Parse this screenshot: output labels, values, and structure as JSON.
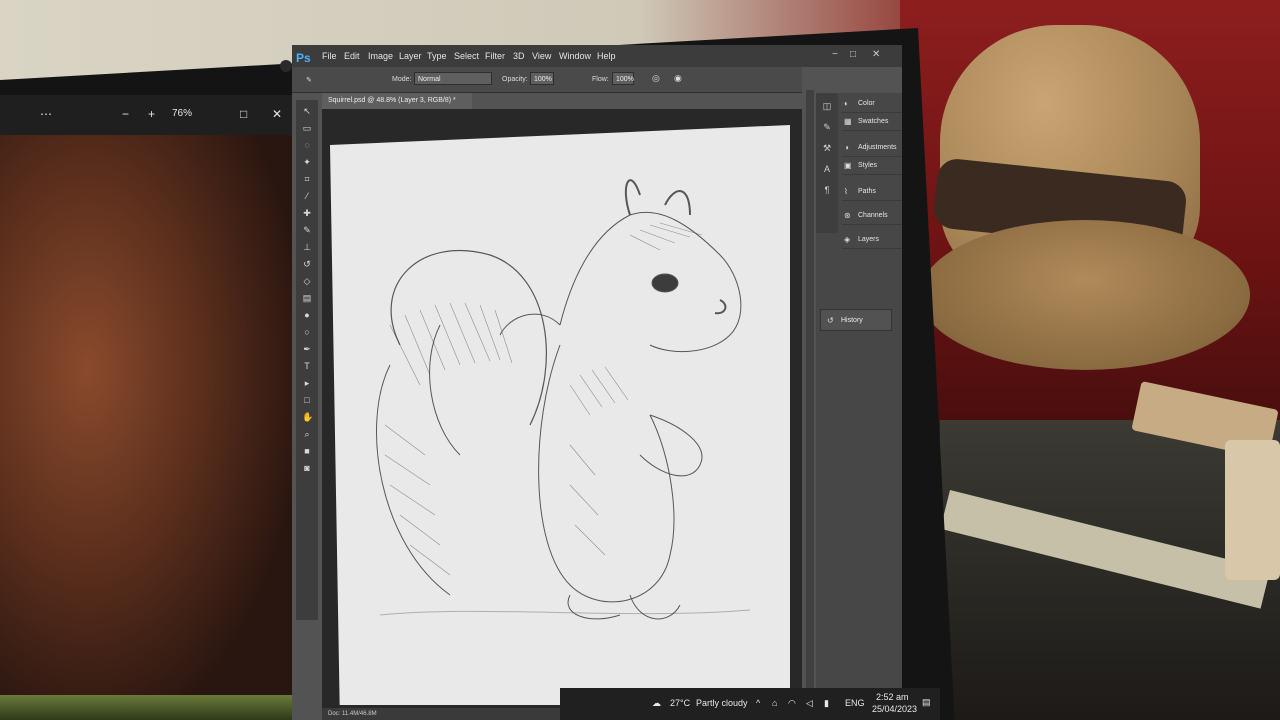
{
  "viewer": {
    "zoom": "76%",
    "buttons": [
      "⋯",
      "−",
      "+",
      "□",
      "✕"
    ]
  },
  "photoshop": {
    "logo": "Ps",
    "menu": [
      "File",
      "Edit",
      "Image",
      "Layer",
      "Type",
      "Select",
      "Filter",
      "3D",
      "View",
      "Window",
      "Help"
    ],
    "options": {
      "mode_label": "Mode:",
      "mode_value": "Normal",
      "opacity_label": "Opacity:",
      "opacity_value": "100%",
      "flow_label": "Flow:",
      "flow_value": "100%"
    },
    "doc_tab": "Squirrel.psd @ 48.8% (Layer 3, RGB/8) *",
    "status": "Doc: 11.4M/46.8M",
    "panels": [
      "Color",
      "Swatches",
      "Adjustments",
      "Styles",
      "Paths",
      "Channels",
      "Layers"
    ],
    "history_label": "History"
  },
  "taskbar": {
    "temperature": "27°C",
    "weather": "Partly cloudy",
    "language": "ENG",
    "time": "2:52 am",
    "date": "25/04/2023"
  },
  "icons": {
    "tools": [
      "move-tool-icon",
      "marquee-tool-icon",
      "lasso-tool-icon",
      "quick-select-icon",
      "crop-tool-icon",
      "eyedropper-icon",
      "healing-brush-icon",
      "brush-tool-icon",
      "clone-stamp-icon",
      "history-brush-icon",
      "eraser-icon",
      "gradient-icon",
      "blur-icon",
      "dodge-icon",
      "pen-tool-icon",
      "type-tool-icon",
      "path-select-icon",
      "shape-tool-icon",
      "hand-tool-icon",
      "zoom-tool-icon"
    ]
  }
}
